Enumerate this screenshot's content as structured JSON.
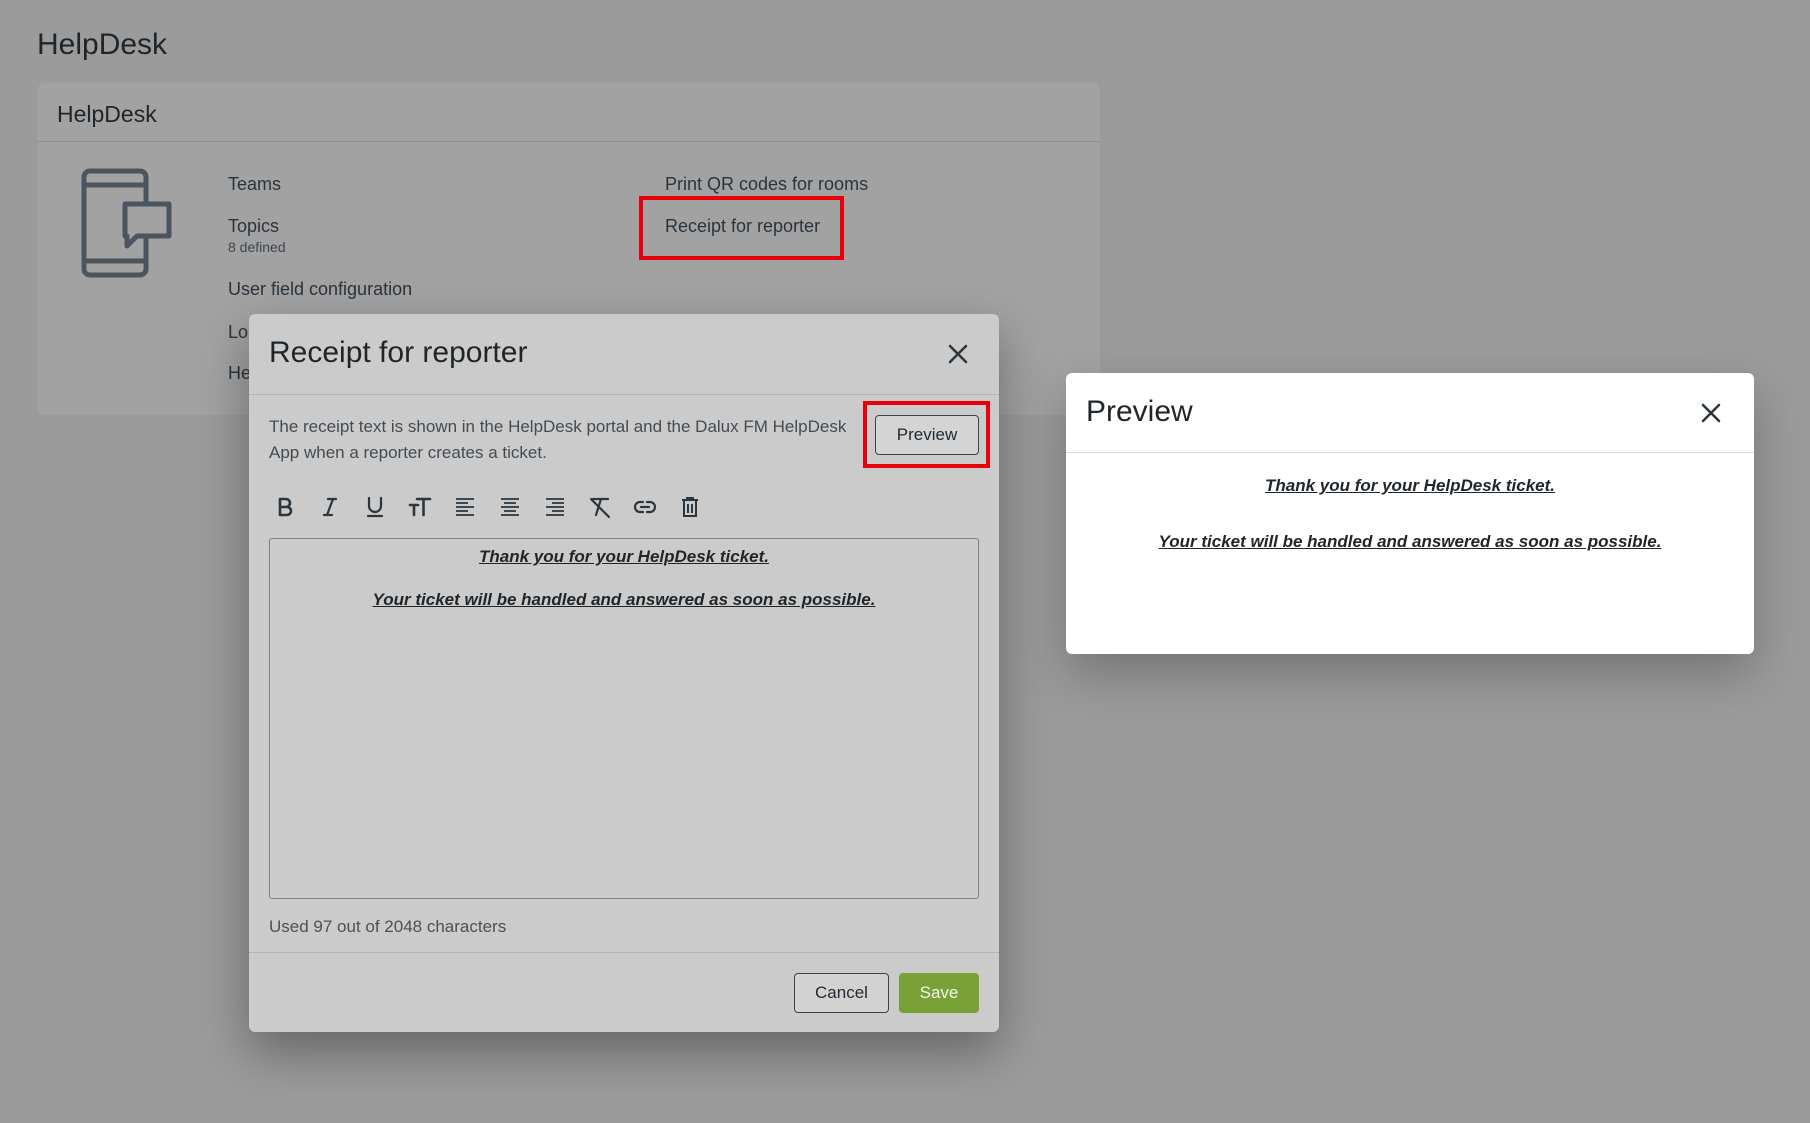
{
  "page": {
    "title": "HelpDesk"
  },
  "card": {
    "title": "HelpDesk",
    "left_links": [
      {
        "label": "Teams"
      },
      {
        "label": "Topics",
        "sub": "8 defined"
      },
      {
        "label": "User field configuration"
      },
      {
        "label": "Lo"
      },
      {
        "label": "He"
      }
    ],
    "right_links": [
      {
        "label": "Print QR codes for rooms"
      },
      {
        "label": "Receipt for reporter"
      }
    ]
  },
  "modal": {
    "title": "Receipt for reporter",
    "description": "The receipt text is shown in the HelpDesk portal and the Dalux FM HelpDesk App when a reporter creates a ticket.",
    "preview_button": "Preview",
    "toolbar": [
      "bold-icon",
      "italic-icon",
      "underline-icon",
      "text-size-icon",
      "align-left-icon",
      "align-center-icon",
      "align-right-icon",
      "clear-format-icon",
      "link-icon",
      "delete-icon"
    ],
    "editor_lines": [
      "Thank you for your HelpDesk ticket.",
      "Your ticket will be handled and answered as soon as possible."
    ],
    "char_count": "Used 97 out of 2048 characters",
    "cancel_label": "Cancel",
    "save_label": "Save"
  },
  "preview": {
    "title": "Preview",
    "lines": [
      "Thank you for your HelpDesk ticket.",
      "Your ticket will be handled and answered as soon as possible."
    ]
  },
  "colors": {
    "overlay": "#9b9b9c",
    "highlight": "#e8000b",
    "save_button": "#78a137",
    "modal_bg": "#cbcbcb"
  }
}
